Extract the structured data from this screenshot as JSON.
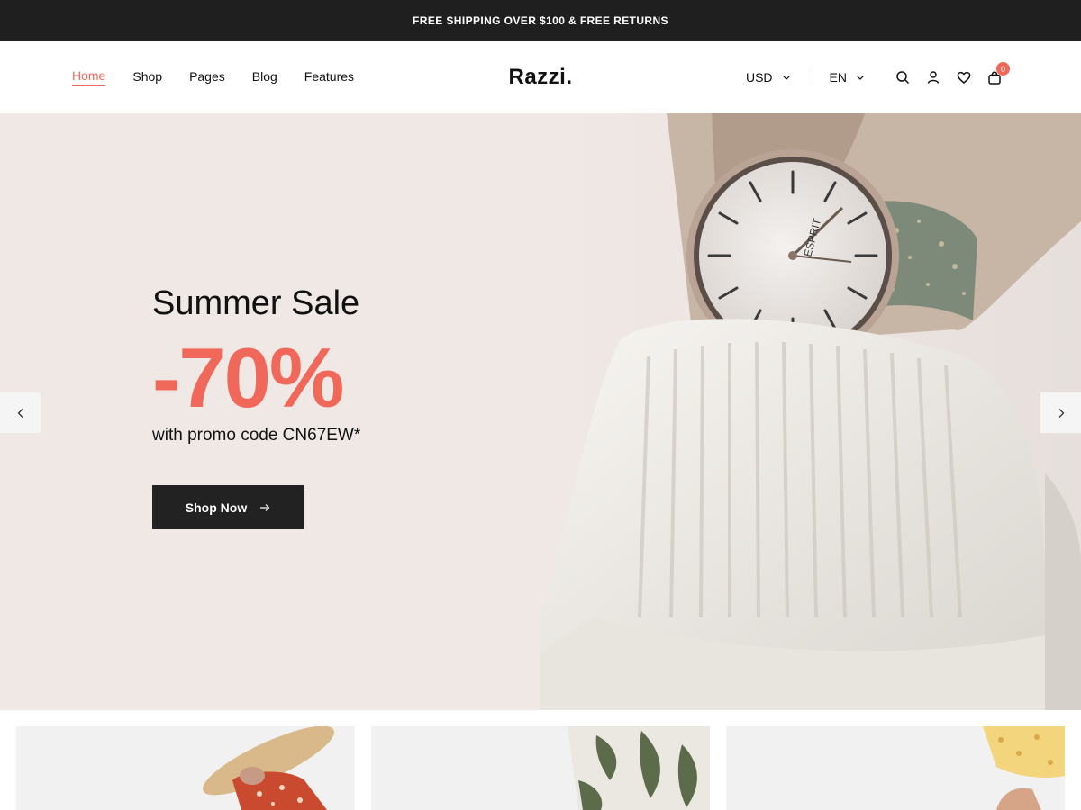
{
  "topbar": {
    "text": "FREE SHIPPING OVER $100 & FREE RETURNS"
  },
  "nav": [
    {
      "label": "Home",
      "active": true
    },
    {
      "label": "Shop",
      "active": false
    },
    {
      "label": "Pages",
      "active": false
    },
    {
      "label": "Blog",
      "active": false
    },
    {
      "label": "Features",
      "active": false
    }
  ],
  "logo": "Razzi.",
  "currency": "USD",
  "language": "EN",
  "cart": {
    "count": "0"
  },
  "icons": [
    "search-icon",
    "user-icon",
    "heart-icon",
    "bag-icon"
  ],
  "hero": {
    "title": "Summer Sale",
    "discount": "-70%",
    "promo": "with promo code CN67EW*",
    "button_label": "Shop Now"
  },
  "watch_brand": "ESPRIT",
  "colors": {
    "accent": "#f0685a",
    "dark": "#1f1f1f",
    "hero_bg": "#f0e8e5"
  }
}
